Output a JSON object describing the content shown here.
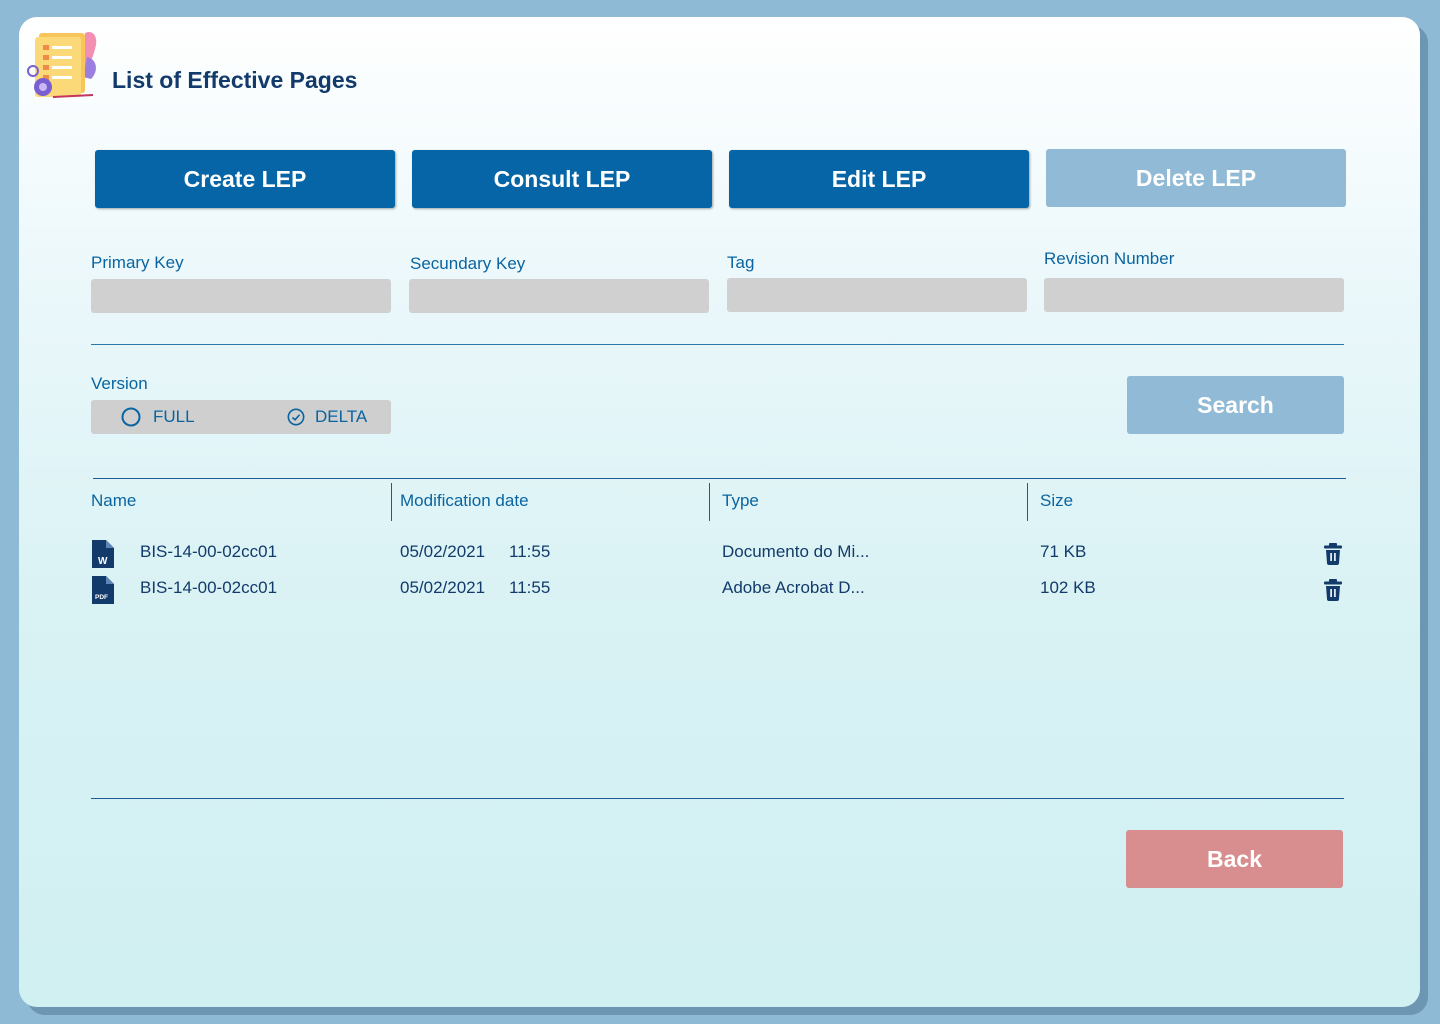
{
  "header": {
    "title": "List of Effective Pages",
    "logo_icon": "document-list-icon"
  },
  "actions": {
    "create": "Create LEP",
    "consult": "Consult LEP",
    "edit": "Edit LEP",
    "delete": "Delete LEP"
  },
  "fields": {
    "primary_key": {
      "label": "Primary Key",
      "value": ""
    },
    "secundary_key": {
      "label": "Secundary Key",
      "value": ""
    },
    "tag": {
      "label": "Tag",
      "value": ""
    },
    "revision_number": {
      "label": "Revision Number",
      "value": ""
    }
  },
  "version": {
    "label": "Version",
    "options": [
      "FULL",
      "DELTA"
    ],
    "selected": "DELTA"
  },
  "search_label": "Search",
  "table": {
    "columns": [
      "Name",
      "Modification date",
      "Type",
      "Size"
    ],
    "rows": [
      {
        "icon": "word-file-icon",
        "name": "BIS-14-00-02cc01",
        "date": "05/02/2021",
        "time": "11:55",
        "type": "Documento do Mi...",
        "size": "71 KB"
      },
      {
        "icon": "pdf-file-icon",
        "name": "BIS-14-00-02cc01",
        "date": "05/02/2021",
        "time": "11:55",
        "type": "Adobe Acrobat D...",
        "size": "102 KB"
      }
    ],
    "file_badges": {
      "word": "W",
      "pdf": "PDF"
    }
  },
  "back_label": "Back",
  "colors": {
    "primary": "#0565a6",
    "disabled": "#91bad6",
    "back": "#d88e8e",
    "text_blue": "#0a64a0",
    "dark_navy": "#123a6b"
  }
}
